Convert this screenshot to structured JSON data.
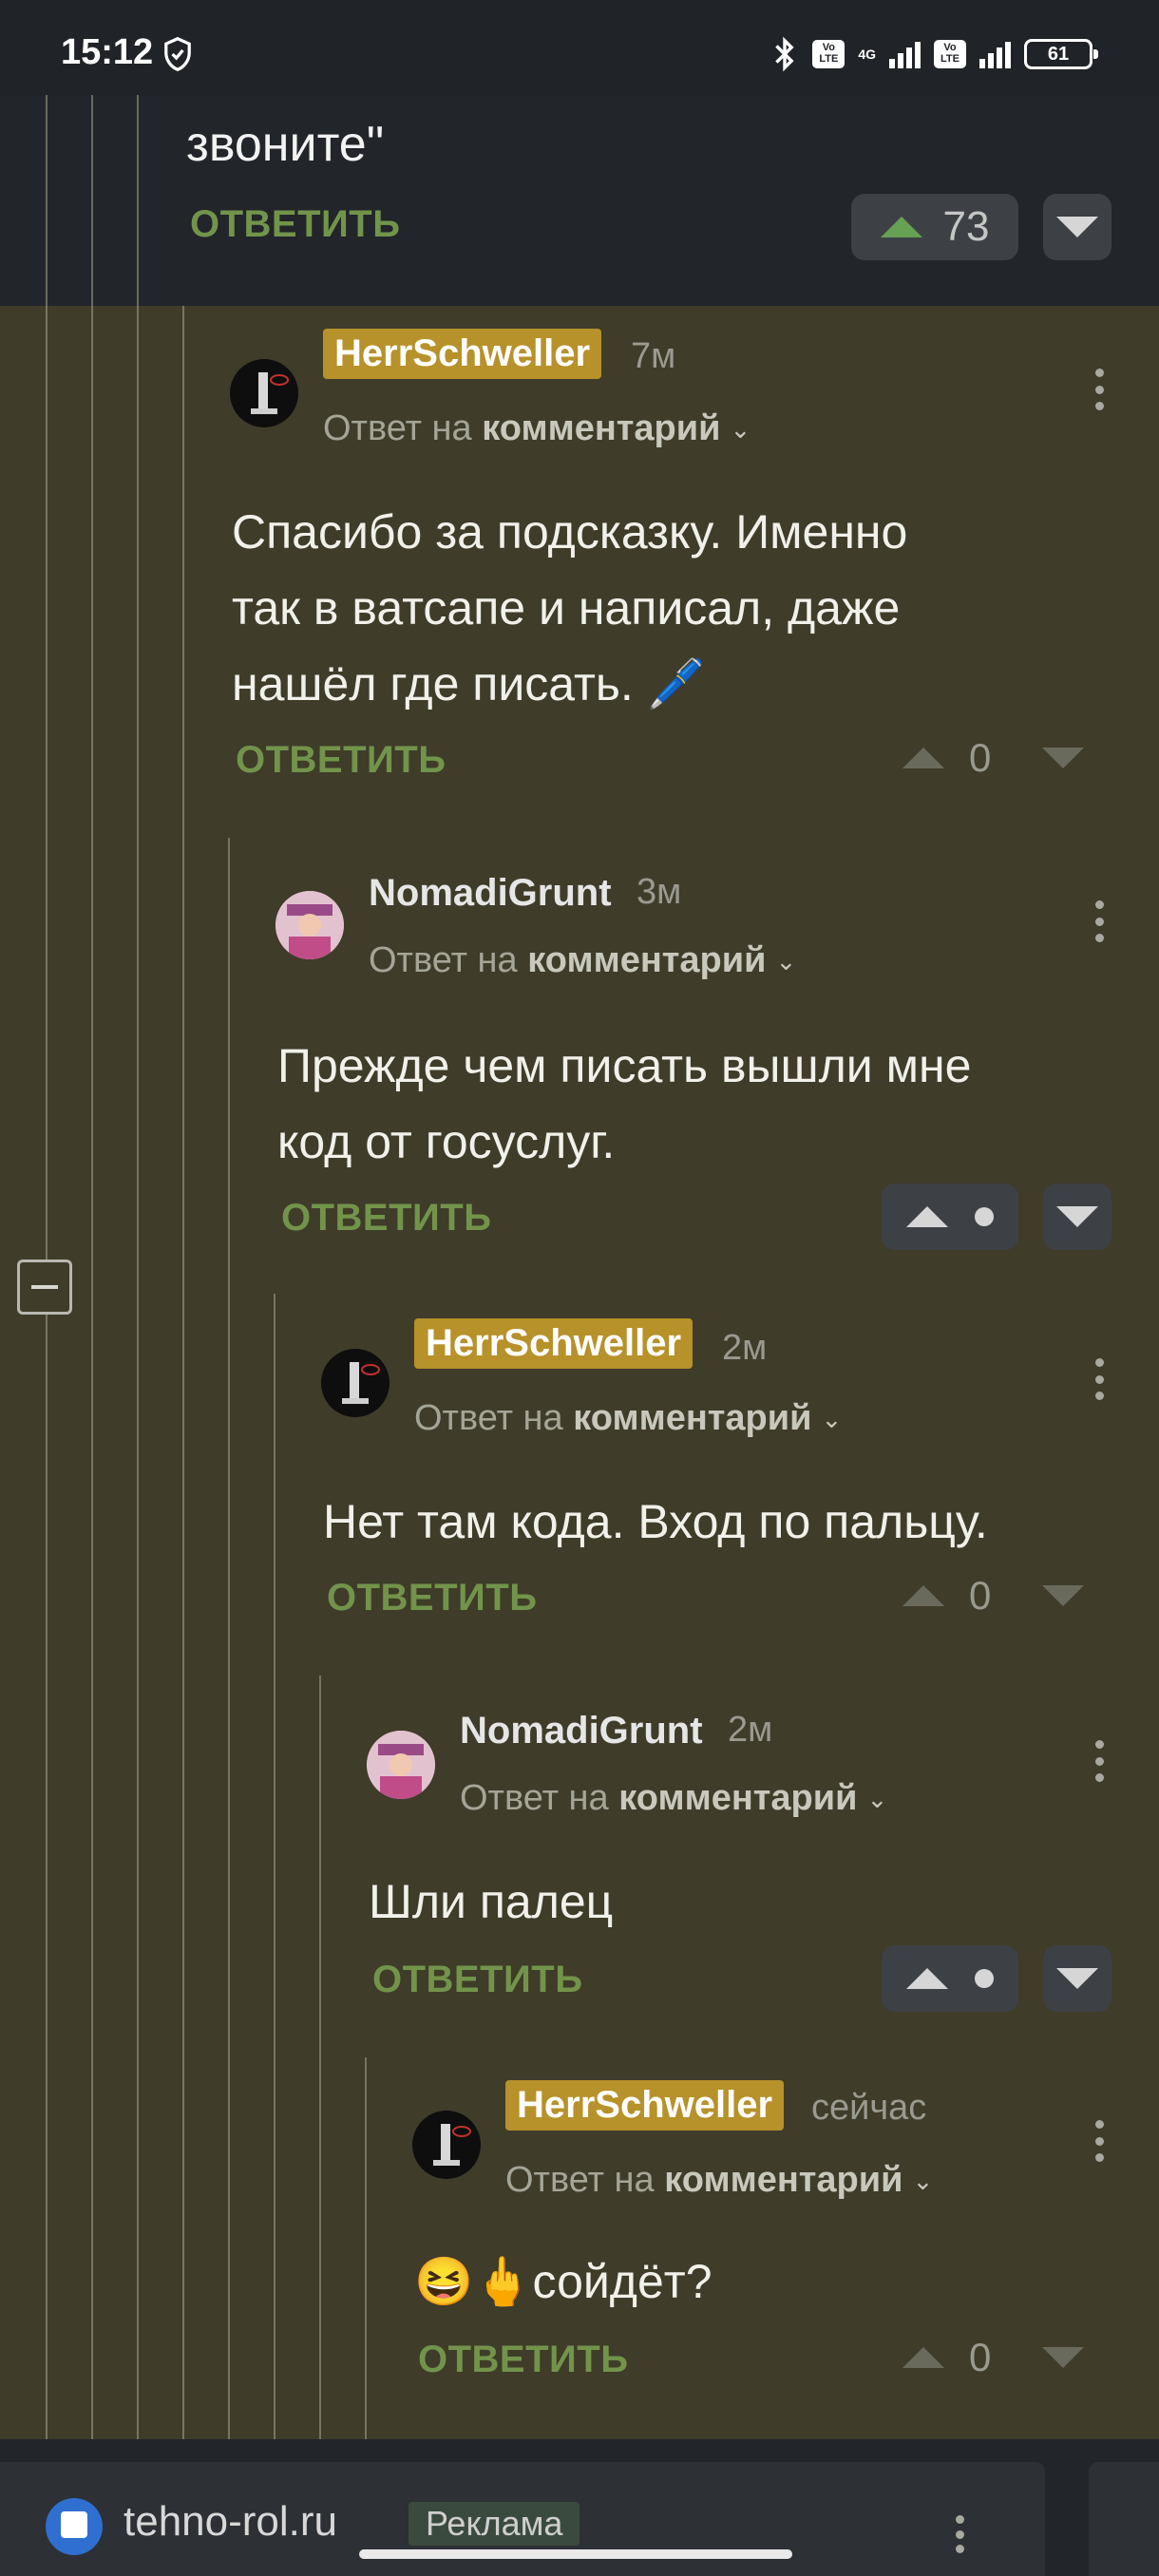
{
  "status_bar": {
    "time": "15:12",
    "network": "4G",
    "volte1": "Vo LTE",
    "volte2": "Vo LTE",
    "battery": "61"
  },
  "top_comment": {
    "text_tail": "звоните\"",
    "reply_label": "ОТВЕТИТЬ",
    "votes": "73"
  },
  "comments": [
    {
      "username": "HerrSchweller",
      "time": "7м",
      "reply_to_prefix": "Ответ на",
      "reply_to_target": "комментарий",
      "text_lines": [
        "Спасибо за подсказку. Именно",
        "так в ватсапе и написал, даже",
        "нашёл где писать. 🖊️"
      ],
      "reply_label": "ОТВЕТИТЬ",
      "votes": "0"
    },
    {
      "username": "NomadiGrunt",
      "time": "3м",
      "reply_to_prefix": "Ответ на",
      "reply_to_target": "комментарий",
      "text_lines": [
        "Прежде чем писать вышли мне",
        "код от госуслуг."
      ],
      "reply_label": "ОТВЕТИТЬ"
    },
    {
      "username": "HerrSchweller",
      "time": "2м",
      "reply_to_prefix": "Ответ на",
      "reply_to_target": "комментарий",
      "text_lines": [
        "Нет там кода. Вход по пальцу."
      ],
      "reply_label": "ОТВЕТИТЬ",
      "votes": "0"
    },
    {
      "username": "NomadiGrunt",
      "time": "2м",
      "reply_to_prefix": "Ответ на",
      "reply_to_target": "комментарий",
      "text_lines": [
        "Шли палец"
      ],
      "reply_label": "ОТВЕТИТЬ"
    },
    {
      "username": "HerrSchweller",
      "time": "сейчас",
      "reply_to_prefix": "Ответ на",
      "reply_to_target": "комментарий",
      "text_lines": [
        "😆🖕сойдёт?"
      ],
      "reply_label": "ОТВЕТИТЬ",
      "votes": "0"
    }
  ],
  "ad": {
    "domain": "tehno-rol.ru",
    "label": "Реклама"
  },
  "colors": {
    "olive_bg": "#3f3c2a",
    "badge": "#b7912a",
    "reply_green": "#72944a",
    "dark_bg": "#22252a"
  }
}
